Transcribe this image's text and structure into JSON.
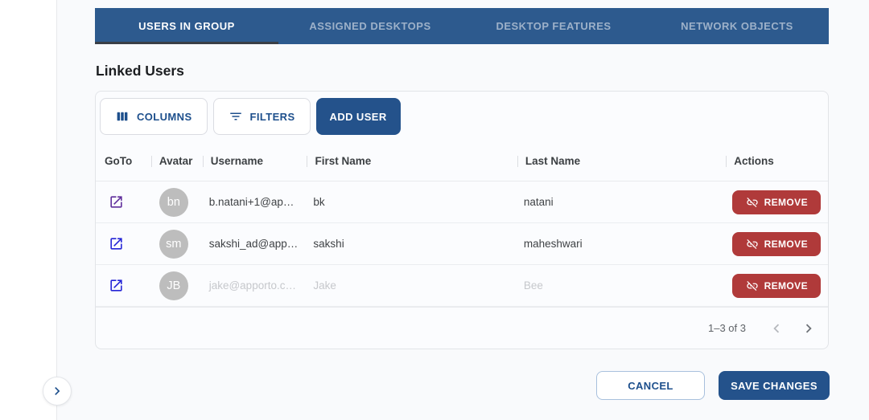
{
  "colors": {
    "tabbar_bg": "#2d5a8e",
    "tab_indicator": "#3a3f46",
    "primary_fill": "#24528b",
    "primary_text": "#1d4f8c",
    "danger": "#b03a3a",
    "avatar_bg": "#bdbdbd",
    "goto_link_visited": "#5e2c9a",
    "goto_link": "#2424d6"
  },
  "tabs": [
    {
      "label": "USERS IN GROUP",
      "active": true
    },
    {
      "label": "ASSIGNED DESKTOPS",
      "active": false
    },
    {
      "label": "DESKTOP FEATURES",
      "active": false
    },
    {
      "label": "NETWORK OBJECTS",
      "active": false
    }
  ],
  "section": {
    "title": "Linked Users"
  },
  "toolbar": {
    "columns": "COLUMNS",
    "filters": "FILTERS",
    "add_user": "ADD USER"
  },
  "table": {
    "headers": [
      "GoTo",
      "Avatar",
      "Username",
      "First Name",
      "Last Name",
      "Actions"
    ],
    "rows": [
      {
        "avatar": "bn",
        "username": "b.natani+1@ap…",
        "first_name": "bk",
        "last_name": "natani",
        "action": "REMOVE"
      },
      {
        "avatar": "sm",
        "username": "sakshi_ad@app…",
        "first_name": "sakshi",
        "last_name": "maheshwari",
        "action": "REMOVE"
      },
      {
        "avatar": "JB",
        "username": "jake@apporto.c…",
        "first_name": "Jake",
        "last_name": "Bee",
        "action": "REMOVE"
      }
    ],
    "pagination": {
      "range": "1–3 of 3"
    }
  },
  "footer": {
    "cancel": "CANCEL",
    "save": "SAVE CHANGES"
  }
}
